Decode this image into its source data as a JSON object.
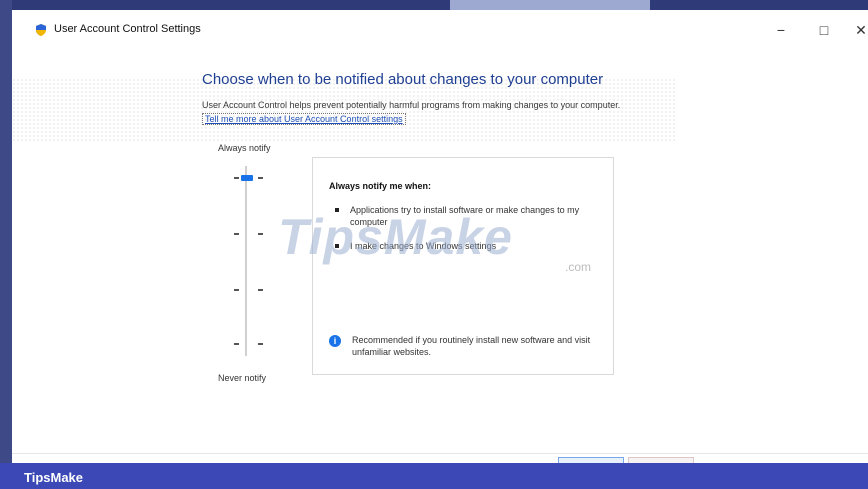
{
  "window": {
    "title": "User Account Control Settings",
    "controls": {
      "minimize": "−",
      "maximize": "□",
      "close": "✕"
    }
  },
  "main": {
    "heading": "Choose when to be notified about changes to your computer",
    "description": "User Account Control helps prevent potentially harmful programs from making changes to your computer.",
    "link_text": "Tell me more about User Account Control settings",
    "slider": {
      "top_label": "Always notify",
      "bottom_label": "Never notify",
      "levels": 4,
      "selected_level": 1
    },
    "panel": {
      "title": "Always notify me when:",
      "bullets": [
        "Applications try to install software or make changes to my computer",
        "I make changes to Windows settings"
      ],
      "recommendation": "Recommended if you routinely install new software and visit unfamiliar websites.",
      "info_icon": "i"
    }
  },
  "watermark": {
    "text": "TipsMake",
    "suffix": ".com"
  },
  "footer_bar": {
    "brand": "TipsMake"
  },
  "colors": {
    "accent": "#1a73e8",
    "heading": "#1f3f93",
    "bottom_bar": "#3b48b5"
  }
}
